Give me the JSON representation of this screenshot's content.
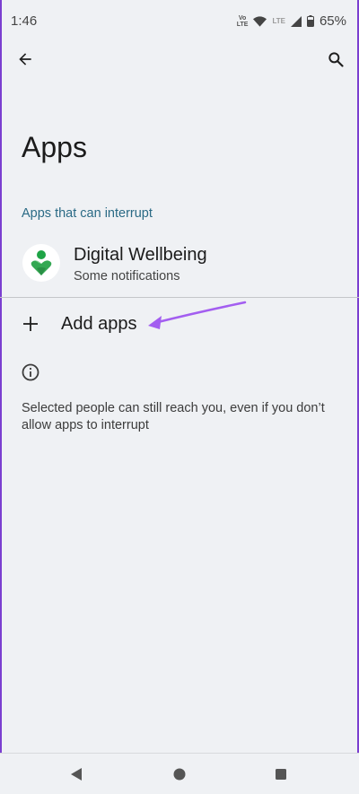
{
  "status_bar": {
    "time": "1:46",
    "volte_top": "Vo",
    "volte_bottom": "LTE",
    "network": "LTE",
    "battery": "65%"
  },
  "header": {
    "back_icon": "arrow-back-icon",
    "search_icon": "search-icon"
  },
  "page": {
    "title": "Apps",
    "section_header": "Apps that can interrupt"
  },
  "apps": [
    {
      "name": "Digital Wellbeing",
      "subtitle": "Some notifications",
      "icon": "digital-wellbeing-icon"
    }
  ],
  "add_apps": {
    "label": "Add apps",
    "icon": "plus-icon"
  },
  "info": {
    "icon": "info-icon",
    "text": "Selected people can still reach you, even if you don’t allow apps to interrupt"
  },
  "annotation": {
    "color": "#a35ef0"
  },
  "colors": {
    "background": "#eff1f4",
    "accent": "#2a6a85",
    "frame": "#7b3fd0"
  }
}
